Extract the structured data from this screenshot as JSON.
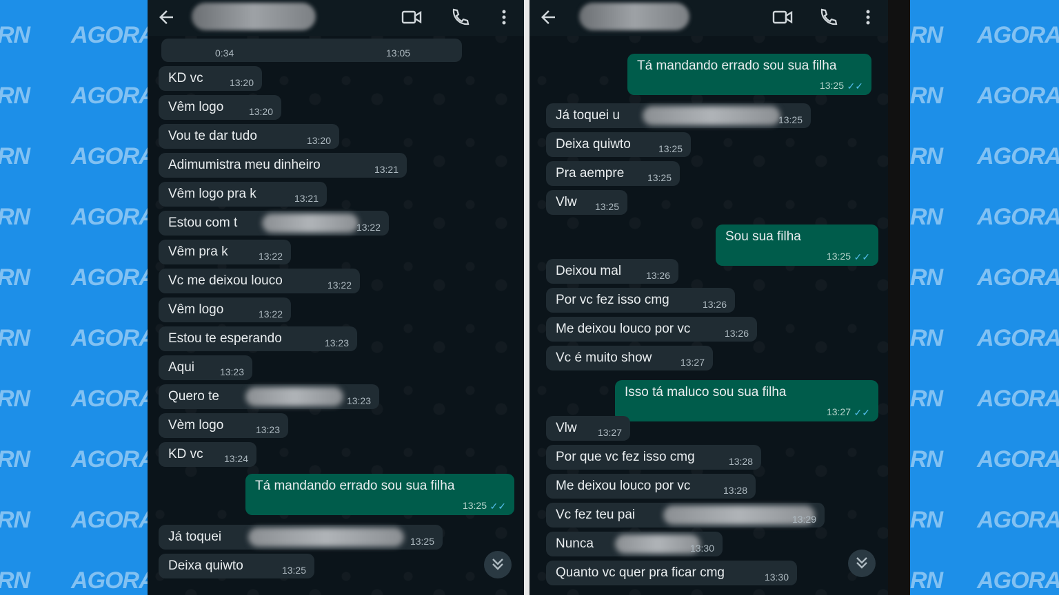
{
  "watermark": {
    "text_left": "RN",
    "text_main": "AGORA"
  },
  "left_chat": {
    "audio": {
      "duration": "0:34",
      "time": "13:05"
    },
    "messages": [
      {
        "text": "KD vc",
        "time": "13:20",
        "dir": "in"
      },
      {
        "text": "Vêm logo",
        "time": "13:20",
        "dir": "in"
      },
      {
        "text": "Vou te dar tudo",
        "time": "13:20",
        "dir": "in"
      },
      {
        "text": "Adimumistra meu dinheiro",
        "time": "13:21",
        "dir": "in"
      },
      {
        "text": "Vêm logo pra k",
        "time": "13:21",
        "dir": "in"
      },
      {
        "text": "Estou com t",
        "time": "13:22",
        "dir": "in",
        "redacted": true
      },
      {
        "text": "Vêm pra k",
        "time": "13:22",
        "dir": "in"
      },
      {
        "text": "Vc me deixou louco",
        "time": "13:22",
        "dir": "in"
      },
      {
        "text": "Vêm logo",
        "time": "13:22",
        "dir": "in"
      },
      {
        "text": "Estou te esperando",
        "time": "13:23",
        "dir": "in"
      },
      {
        "text": "Aqui",
        "time": "13:23",
        "dir": "in"
      },
      {
        "text": "Quero te",
        "time": "13:23",
        "dir": "in",
        "redacted": true
      },
      {
        "text": "Vèm logo",
        "time": "13:23",
        "dir": "in"
      },
      {
        "text": "KD vc",
        "time": "13:24",
        "dir": "in"
      },
      {
        "text": "Tá mandando errado sou sua filha",
        "time": "13:25",
        "dir": "out"
      },
      {
        "text": "Já toquei",
        "time": "13:25",
        "dir": "in",
        "redacted": true
      },
      {
        "text": "Deixa quiwto",
        "time": "13:25",
        "dir": "in"
      }
    ]
  },
  "right_chat": {
    "messages": [
      {
        "text": "Tá mandando errado sou sua filha",
        "time": "13:25",
        "dir": "out"
      },
      {
        "text": "Já toquei u",
        "time": "13:25",
        "dir": "in",
        "redacted": true
      },
      {
        "text": "Deixa quiwto",
        "time": "13:25",
        "dir": "in"
      },
      {
        "text": "Pra aempre",
        "time": "13:25",
        "dir": "in"
      },
      {
        "text": "Vlw",
        "time": "13:25",
        "dir": "in"
      },
      {
        "text": "Sou sua filha",
        "time": "13:25",
        "dir": "out"
      },
      {
        "text": "Deixou mal",
        "time": "13:26",
        "dir": "in"
      },
      {
        "text": "Por vc fez isso cmg",
        "time": "13:26",
        "dir": "in"
      },
      {
        "text": "Me deixou louco por vc",
        "time": "13:26",
        "dir": "in"
      },
      {
        "text": "Vc é muito show",
        "time": "13:27",
        "dir": "in"
      },
      {
        "text": "Isso tá maluco sou sua filha",
        "time": "13:27",
        "dir": "out"
      },
      {
        "text": "Vlw",
        "time": "13:27",
        "dir": "in"
      },
      {
        "text": "Por que vc fez isso cmg",
        "time": "13:28",
        "dir": "in"
      },
      {
        "text": "Me deixou louco por vc",
        "time": "13:28",
        "dir": "in"
      },
      {
        "text": "Vc fez teu pai",
        "time": "13:29",
        "dir": "in",
        "redacted": true
      },
      {
        "text": "Nunca",
        "time": "13:30",
        "dir": "in",
        "redacted": true
      },
      {
        "text": "Quanto vc quer pra ficar cmg",
        "time": "13:30",
        "dir": "in"
      }
    ]
  },
  "icons": {
    "back": "arrow-left-icon",
    "video": "video-call-icon",
    "call": "phone-icon",
    "menu": "more-vertical-icon",
    "scroll": "double-chevron-down-icon",
    "read": "double-check-icon"
  },
  "colors": {
    "background": "#1d8fe8",
    "chat_bg": "#0b141a",
    "incoming": "#202c33",
    "outgoing": "#005c4b",
    "ticks": "#53bdeb"
  }
}
